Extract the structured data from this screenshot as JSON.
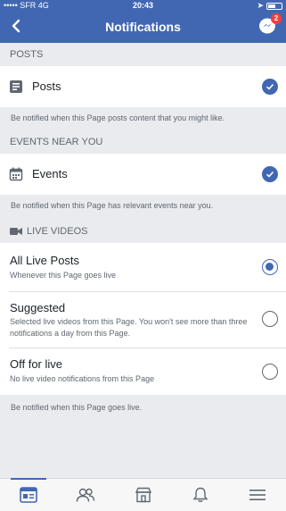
{
  "status_bar": {
    "carrier": "SFR",
    "network": "4G",
    "time": "20:43"
  },
  "header": {
    "title": "Notifications",
    "messenger_badge": "2"
  },
  "sections": {
    "posts": {
      "header": "POSTS",
      "item_label": "Posts",
      "checked": true,
      "note": "Be notified when this Page posts content that you might like."
    },
    "events": {
      "header": "EVENTS NEAR YOU",
      "item_label": "Events",
      "checked": true,
      "note": "Be notified when this Page has relevant events near you."
    },
    "live": {
      "header": "LIVE VIDEOS",
      "options": [
        {
          "label": "All Live Posts",
          "sub": "Whenever this Page goes live",
          "selected": true
        },
        {
          "label": "Suggested",
          "sub": "Selected live videos from this Page. You won't see more than three notifications a day from this Page.",
          "selected": false
        },
        {
          "label": "Off for live",
          "sub": "No live video notifications from this Page",
          "selected": false
        }
      ],
      "note": "Be notified when this Page goes live."
    }
  },
  "colors": {
    "brand": "#4267b2",
    "background": "#e9ebee",
    "text_secondary": "#606770"
  },
  "tabbar": {
    "tabs": [
      "page-icon",
      "people-icon",
      "shop-icon",
      "bell-icon",
      "menu-icon"
    ],
    "active": 0
  }
}
